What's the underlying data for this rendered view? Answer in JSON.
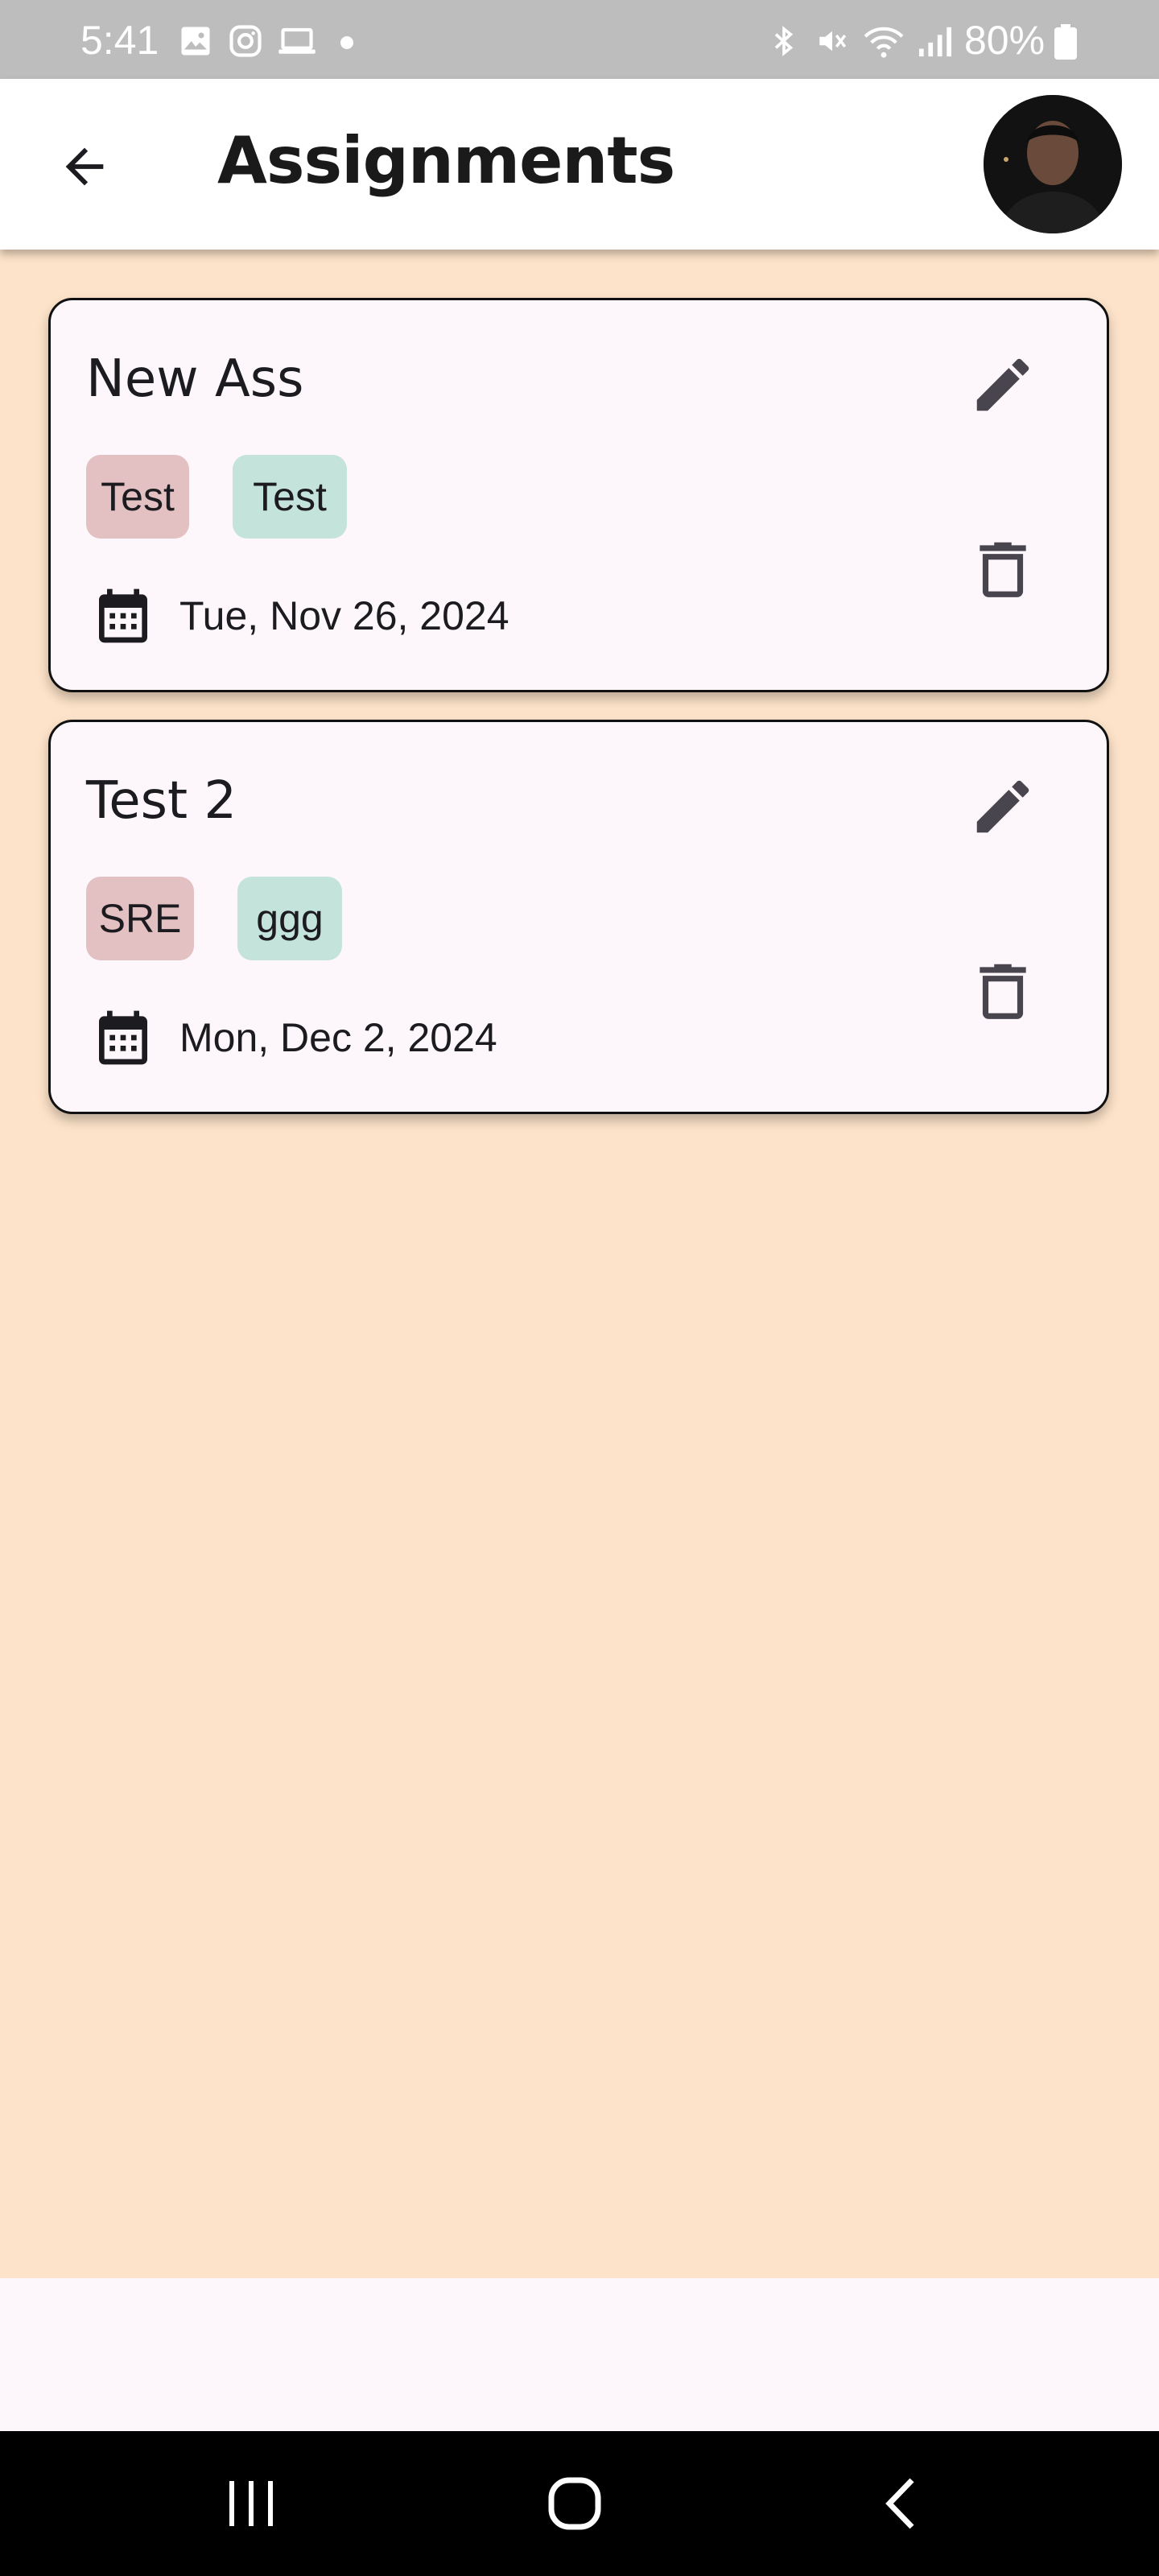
{
  "status_bar": {
    "time": "5:41",
    "battery": "80%",
    "icons": [
      "gallery-icon",
      "instagram-icon",
      "laptop-icon",
      "dot-icon",
      "bluetooth-icon",
      "mute-icon",
      "wifi-icon",
      "signal-icon",
      "battery-icon"
    ]
  },
  "app_bar": {
    "title": "Assignments",
    "back_icon": "arrow-left-icon",
    "avatar": "profile-photo"
  },
  "assignments": [
    {
      "title": "New Ass",
      "tags": [
        "Test",
        "Test"
      ],
      "date": "Tue, Nov 26, 2024"
    },
    {
      "title": "Test 2",
      "tags": [
        "SRE",
        "ggg"
      ],
      "date": "Mon, Dec 2, 2024"
    }
  ],
  "colors": {
    "background": "#fde3c9",
    "card": "#fdf7fb",
    "chip_red": "#e3c0c2",
    "chip_teal": "#c4e3da",
    "icon": "#49454f"
  },
  "nav_bar": {
    "icons": [
      "recent-apps-icon",
      "home-icon",
      "back-icon"
    ]
  }
}
